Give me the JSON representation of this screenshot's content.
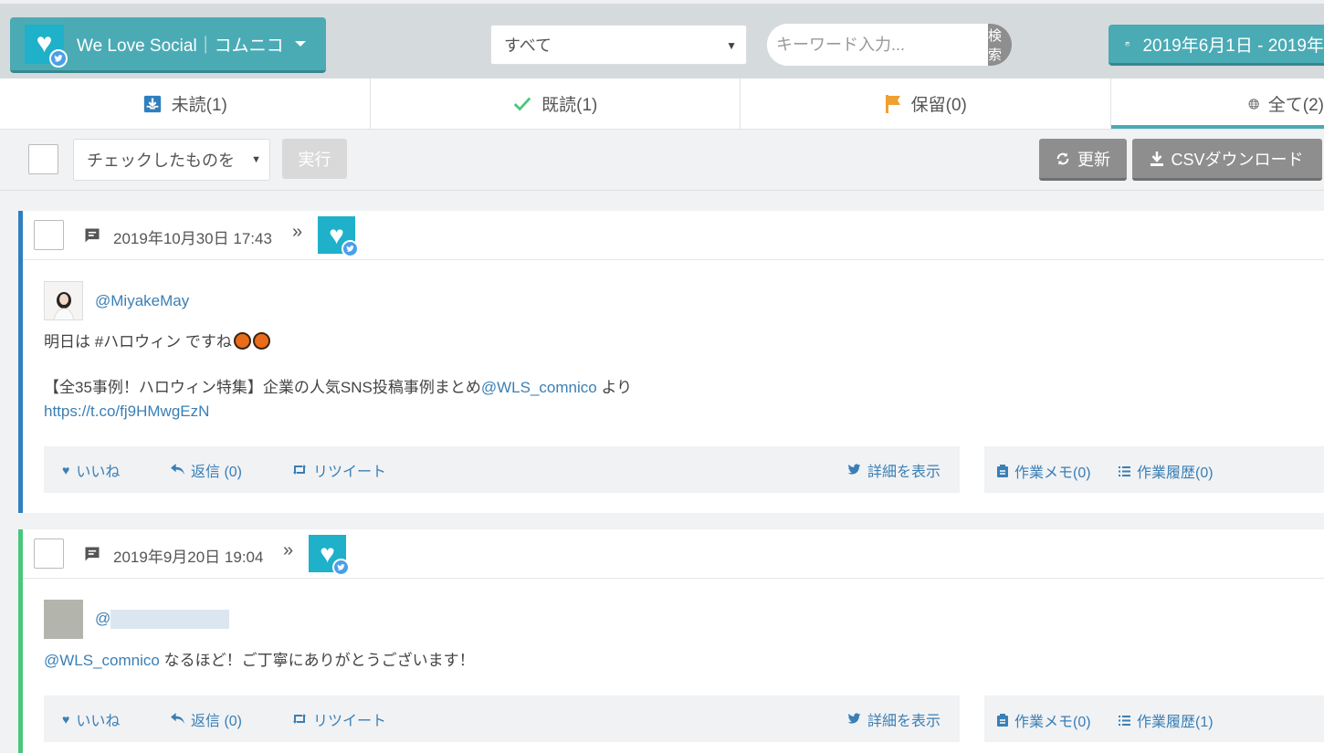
{
  "header": {
    "account_name": "We Love Social｜コムニコ",
    "filter_value": "すべて",
    "search_placeholder": "キーワード入力...",
    "search_button": "検索",
    "date_range": "2019年6月1日 - 2019年"
  },
  "tabs": [
    {
      "label": "未読(1)",
      "icon": "inbox-download-icon",
      "color": "#2f7fbf"
    },
    {
      "label": "既読(1)",
      "icon": "check-icon",
      "color": "#48c77b"
    },
    {
      "label": "保留(0)",
      "icon": "flag-icon",
      "color": "#f0a030"
    },
    {
      "label": "全て(2)",
      "icon": "globe-icon",
      "color": "#777"
    }
  ],
  "actionbar": {
    "bulk_action": "チェックしたものを",
    "execute": "実行",
    "refresh": "更新",
    "csv": "CSVダウンロード"
  },
  "posts": [
    {
      "date": "2019年10月30日 17:43",
      "arrow": "»",
      "handle": "@MiyakeMay",
      "line1": "明日は #ハロウィン ですね",
      "line2_prefix": "【全35事例！ハロウィン特集】企業の人気SNS投稿事例まとめ",
      "line2_mention": "@WLS_comnico",
      "line2_suffix": " より",
      "url": "https://t.co/fj9HMwgEzN",
      "like": "いいね",
      "reply": "返信 (0)",
      "retweet": "リツイート",
      "detail": "詳細を表示",
      "memo": "作業メモ(0)",
      "history": "作業履歴(0)"
    },
    {
      "date": "2019年9月20日 19:04",
      "arrow": "»",
      "handle": "@",
      "mention": "@WLS_comnico",
      "text": " なるほど！ご丁寧にありがとうございます！",
      "like": "いいね",
      "reply": "返信 (0)",
      "retweet": "リツイート",
      "detail": "詳細を表示",
      "memo": "作業メモ(0)",
      "history": "作業履歴(1)"
    }
  ]
}
